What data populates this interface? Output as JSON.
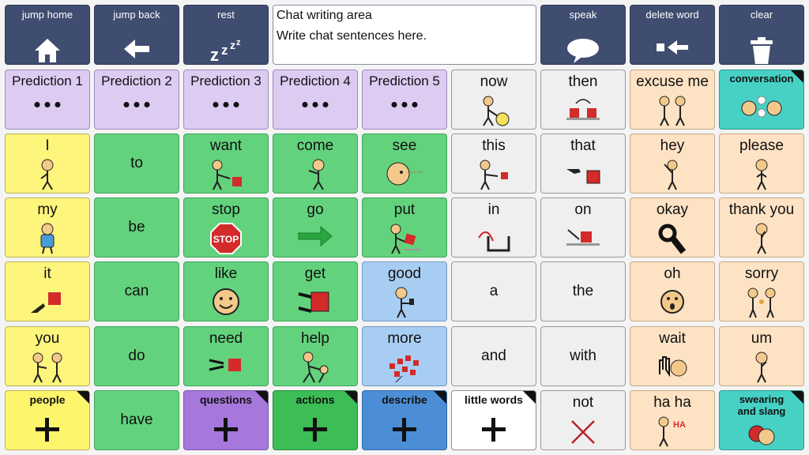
{
  "top_bar": {
    "jump_home": {
      "label": "jump home",
      "icon": "house-icon"
    },
    "jump_back": {
      "label": "jump back",
      "icon": "arrow-left-icon"
    },
    "rest": {
      "label": "rest",
      "icon": "zzz-icon"
    },
    "chat": {
      "title": "Chat writing area",
      "subtitle": "Write chat sentences here."
    },
    "speak": {
      "label": "speak",
      "icon": "speech-bubble-icon"
    },
    "delete_word": {
      "label": "delete word",
      "icon": "delete-arrow-icon"
    },
    "clear": {
      "label": "clear",
      "icon": "trash-icon"
    }
  },
  "predictions": [
    "Prediction 1",
    "Prediction 2",
    "Prediction 3",
    "Prediction 4",
    "Prediction 5"
  ],
  "words": {
    "now": "now",
    "then": "then",
    "excuse_me": "excuse me",
    "conversation": "conversation",
    "I": "I",
    "to": "to",
    "want": "want",
    "come": "come",
    "see": "see",
    "this": "this",
    "that": "that",
    "hey": "hey",
    "please": "please",
    "my": "my",
    "be": "be",
    "stop": "stop",
    "stop_sign": "STOP",
    "go": "go",
    "put": "put",
    "in": "in",
    "on": "on",
    "okay": "okay",
    "thank_you": "thank you",
    "it": "it",
    "can": "can",
    "like": "like",
    "get": "get",
    "good": "good",
    "a": "a",
    "the": "the",
    "oh": "oh",
    "sorry": "sorry",
    "you": "you",
    "do": "do",
    "need": "need",
    "help": "help",
    "more": "more",
    "and": "and",
    "with": "with",
    "wait": "wait",
    "um": "um",
    "people": "people",
    "have": "have",
    "questions": "questions",
    "actions": "actions",
    "describe": "describe",
    "little_words": "little words",
    "not": "not",
    "ha_ha": "ha ha",
    "ha_text": "HA",
    "swearing_1": "swearing",
    "swearing_2": "and slang"
  },
  "colors": {
    "top_bar": "#3f4d70",
    "people_yellow": "#fdf57c",
    "verbs_green": "#63d27c",
    "describe_blue": "#a8cdf3",
    "little_words_grey": "#efefef",
    "social_peach": "#fde2c4",
    "prediction_lavender": "#ddcbf2",
    "teal": "#47d1c5"
  }
}
